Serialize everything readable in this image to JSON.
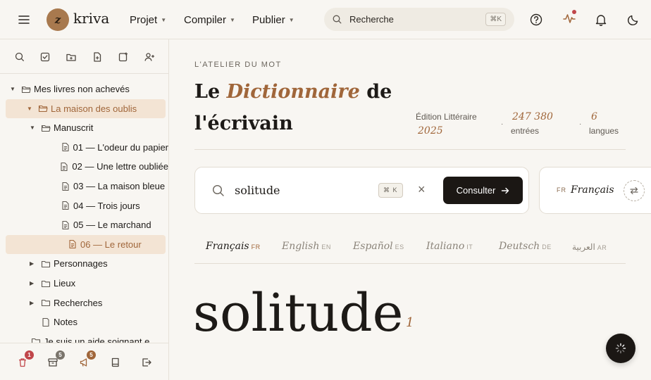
{
  "app": {
    "logo_letter": "z",
    "name": "kriva"
  },
  "nav": {
    "menus": [
      "Projet",
      "Compiler",
      "Publier"
    ]
  },
  "search": {
    "placeholder": "Recherche",
    "shortcut": "⌘K"
  },
  "colors": {
    "accent": "#a0663a",
    "logo": "#a8794e",
    "selection": "#f3e4d4",
    "notification": "#c0464a",
    "dark_button": "#1b1714"
  },
  "sidebar": {
    "tools": [
      "search-icon",
      "task-check-icon",
      "folder-plus-icon",
      "file-plus-icon",
      "note-plus-icon",
      "user-plus-icon"
    ],
    "tree": [
      {
        "label": "Mes livres non achevés",
        "type": "folder",
        "level": 0,
        "expanded": true
      },
      {
        "label": "La maison des oublis",
        "type": "folder",
        "level": 1,
        "expanded": true,
        "selected": true
      },
      {
        "label": "Manuscrit",
        "type": "folder",
        "level": 2,
        "expanded": true
      },
      {
        "label": "01 — L'odeur du papier",
        "type": "doc",
        "level": 3
      },
      {
        "label": "02 — Une lettre oubliée",
        "type": "doc",
        "level": 3
      },
      {
        "label": "03 — La maison bleue",
        "type": "doc",
        "level": 3
      },
      {
        "label": "04 — Trois jours",
        "type": "doc",
        "level": 3
      },
      {
        "label": "05 — Le marchand",
        "type": "doc",
        "level": 3
      },
      {
        "label": "06 — Le retour",
        "type": "doc",
        "level": 3,
        "selected": true
      },
      {
        "label": "Personnages",
        "type": "folder",
        "level": 2,
        "expanded": false
      },
      {
        "label": "Lieux",
        "type": "folder",
        "level": 2,
        "expanded": false
      },
      {
        "label": "Recherches",
        "type": "folder",
        "level": 2,
        "expanded": false
      },
      {
        "label": "Notes",
        "type": "note",
        "level": 2
      },
      {
        "label": "Je suis un aide soignant e",
        "type": "folder",
        "level": 1
      }
    ],
    "footer": {
      "trash_count": "1",
      "archive_count": "5",
      "announce_count": "5"
    }
  },
  "main": {
    "eyebrow": "L'ATELIER DU MOT",
    "title_before": "Le ",
    "title_em": "Dictionnaire",
    "title_after": " de l'écrivain",
    "meta": {
      "edition_label": "Édition Littéraire",
      "edition_year": "2025",
      "entries_count": "247 380",
      "entries_label": "entrées",
      "languages_count": "6",
      "languages_label": "langues",
      "separator": "·"
    },
    "query": {
      "value": "solitude",
      "shortcut": "⌘ K",
      "clear": "×",
      "submit_label": "Consulter"
    },
    "source_lang": {
      "code": "FR",
      "name": "Français"
    },
    "tabs": [
      {
        "label": "Français",
        "code": "FR",
        "active": true
      },
      {
        "label": "English",
        "code": "EN"
      },
      {
        "label": "Español",
        "code": "ES"
      },
      {
        "label": "Italiano",
        "code": "IT"
      },
      {
        "label": "Deutsch",
        "code": "DE"
      },
      {
        "label": "العربية",
        "code": "AR"
      }
    ],
    "headword": "solitude",
    "homograph": "1"
  }
}
